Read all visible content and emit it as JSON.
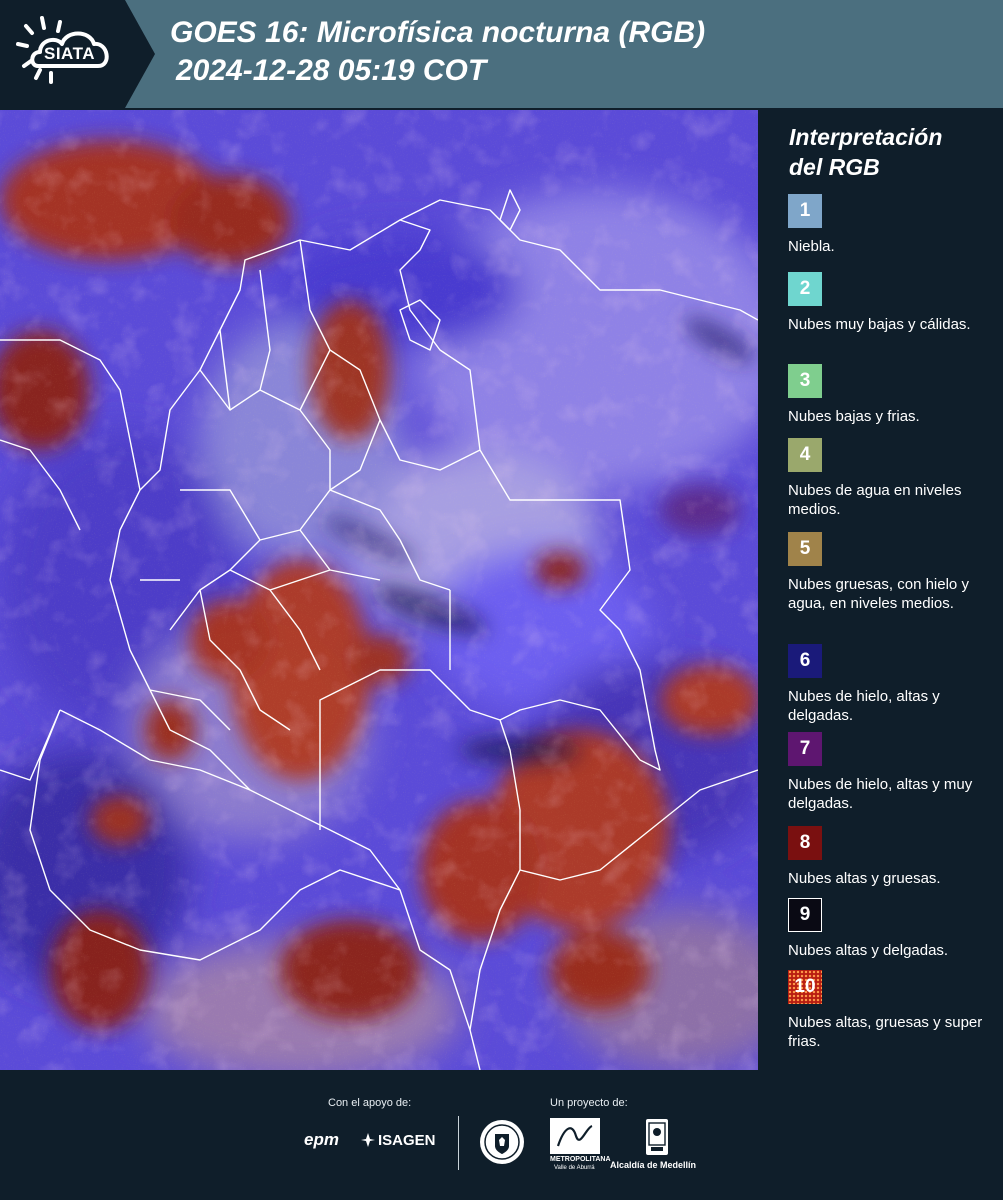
{
  "header": {
    "logo_text": "SIATA",
    "title_line1": "GOES 16: Microfísica nocturna (RGB)",
    "title_line2": "2024-12-28 05:19 COT"
  },
  "legend": {
    "title_line1": "Interpretación",
    "title_line2": "del RGB",
    "items": [
      {
        "number": "1",
        "color": "#7fa6c9",
        "label": "Niebla."
      },
      {
        "number": "2",
        "color": "#6fd6cf",
        "label": "Nubes muy bajas y cálidas."
      },
      {
        "number": "3",
        "color": "#7fce8e",
        "label": "Nubes bajas y frias."
      },
      {
        "number": "4",
        "color": "#9aa86c",
        "label": "Nubes de agua en niveles medios."
      },
      {
        "number": "5",
        "color": "#a0834a",
        "label": "Nubes gruesas, con hielo y agua, en niveles medios."
      },
      {
        "number": "6",
        "color": "#1a1a7a",
        "label": "Nubes de hielo, altas y delgadas."
      },
      {
        "number": "7",
        "color": "#5e1670",
        "label": "Nubes de hielo, altas y muy delgadas."
      },
      {
        "number": "8",
        "color": "#7a1010",
        "label": "Nubes altas y gruesas."
      },
      {
        "number": "9",
        "color": "#0a0a14",
        "label": "Nubes altas y delgadas."
      },
      {
        "number": "10",
        "color": "#b81e12",
        "label": "Nubes altas, gruesas y super frias."
      }
    ]
  },
  "footer": {
    "support_caption": "Con el apoyo de:",
    "project_caption": "Un proyecto de:",
    "sponsor_epm": "epm",
    "sponsor_isagen": "ISAGEN",
    "area_text": "METROPOLITANA",
    "area_sub": "Valle de Aburrá",
    "alcaldia": "Alcaldía de Medellín"
  }
}
